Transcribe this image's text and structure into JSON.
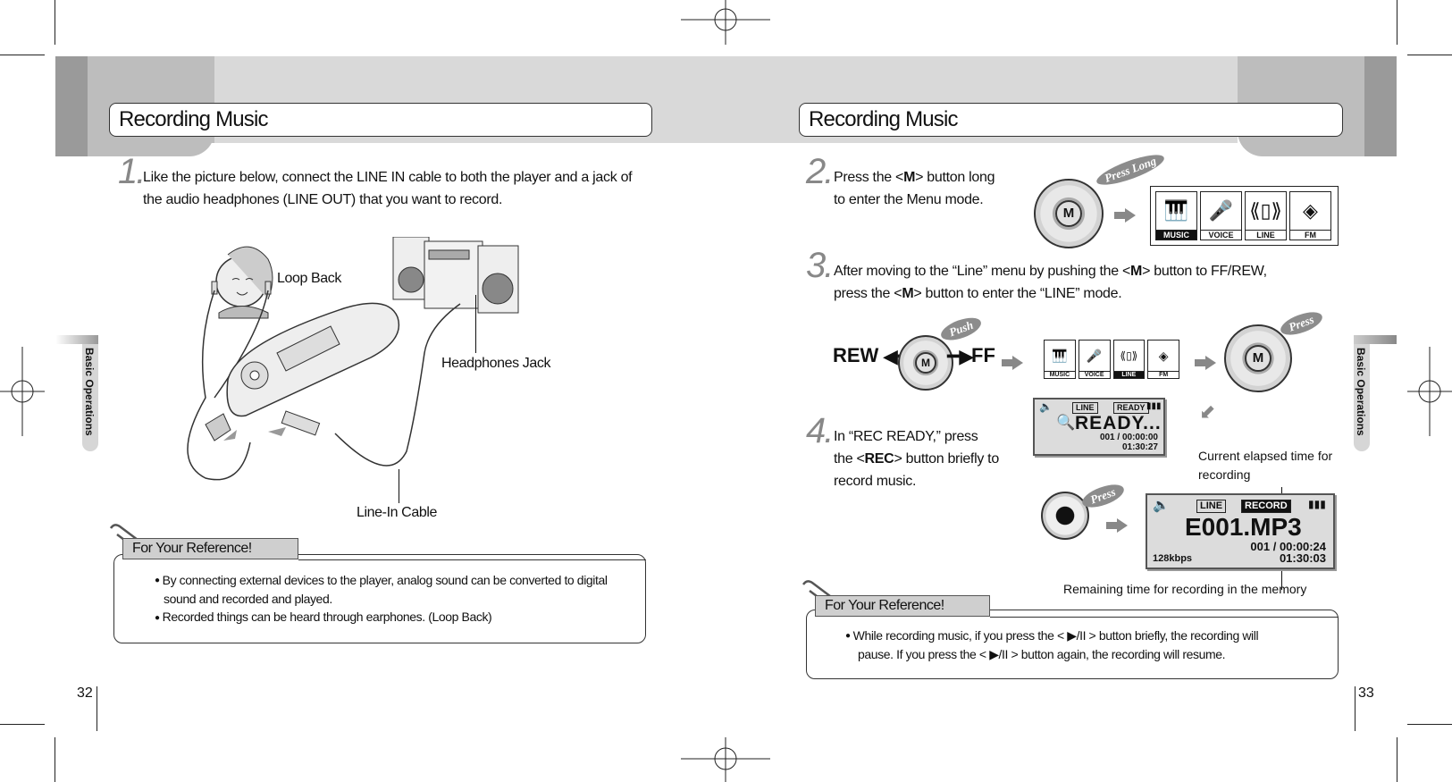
{
  "left_page": {
    "title": "Recording Music",
    "side_tab": "Basic Operations",
    "page_number": "32",
    "step1": {
      "number": "1.",
      "text_line1": "Like the picture below, connect the LINE IN cable to both the player and a jack of",
      "text_line2": "the audio headphones (LINE OUT) that you want to record."
    },
    "illustration_labels": {
      "loop_back": "Loop Back",
      "headphones_jack": "Headphones Jack",
      "line_in_cable": "Line-In Cable"
    },
    "reference": {
      "heading": "For Your Reference!",
      "bullets": [
        "By connecting external devices to the player, analog sound can be converted to digital",
        "sound and recorded and played.",
        "Recorded things can be heard through earphones. (Loop Back)"
      ]
    }
  },
  "right_page": {
    "title": "Recording Music",
    "side_tab": "Basic Operations",
    "page_number": "33",
    "step2": {
      "number": "2.",
      "line1_pre": "Press the <",
      "line1_bold": "M",
      "line1_post": "> button long",
      "line2": "to enter the Menu mode.",
      "badge": "Press Long",
      "wheel_label": "M"
    },
    "menu_items": [
      {
        "label": "MUSIC",
        "icon": "piano-icon"
      },
      {
        "label": "VOICE",
        "icon": "microphone-icon"
      },
      {
        "label": "LINE",
        "icon": "line-in-icon"
      },
      {
        "label": "FM",
        "icon": "radio-icon"
      }
    ],
    "menu_selected_step2": "MUSIC",
    "menu_selected_step3": "LINE",
    "step3": {
      "number": "3.",
      "line1_pre": "After moving to the “Line” menu by pushing the <",
      "line1_bold": "M",
      "line1_post": "> button to FF/REW,",
      "line2_pre": "press the <",
      "line2_bold": "M",
      "line2_post": "> button to enter the “LINE” mode.",
      "rew_label": "REW",
      "ff_label": "FF",
      "push_badge": "Push",
      "press_badge": "Press",
      "wheel_label": "M"
    },
    "step4": {
      "number": "4.",
      "line1": "In “REC READY,” press",
      "line2_pre": "the <",
      "line2_bold": "REC",
      "line2_post": "> button briefly to",
      "line3": "record music.",
      "press_badge": "Press"
    },
    "lcd_ready": {
      "tag_line": "LINE",
      "tag_status": "READY",
      "main": "READY...",
      "track_time": "001 / 00:00:00",
      "remaining": "01:30:27"
    },
    "lcd_record": {
      "tag_line": "LINE",
      "tag_status": "RECORD",
      "main": "E001.MP3",
      "track_time": "001 / 00:00:24",
      "remaining": "01:30:03",
      "bitrate": "128kbps"
    },
    "annotations": {
      "elapsed_line1": "Current elapsed time for",
      "elapsed_line2": "recording",
      "remaining": "Remaining time for recording in the memory"
    },
    "reference": {
      "heading": "For Your Reference!",
      "line1": "While recording music, if you press the < ▶/II > button briefly, the recording will",
      "line2": "pause. If you press the < ▶/II > button again, the recording will resume."
    }
  }
}
